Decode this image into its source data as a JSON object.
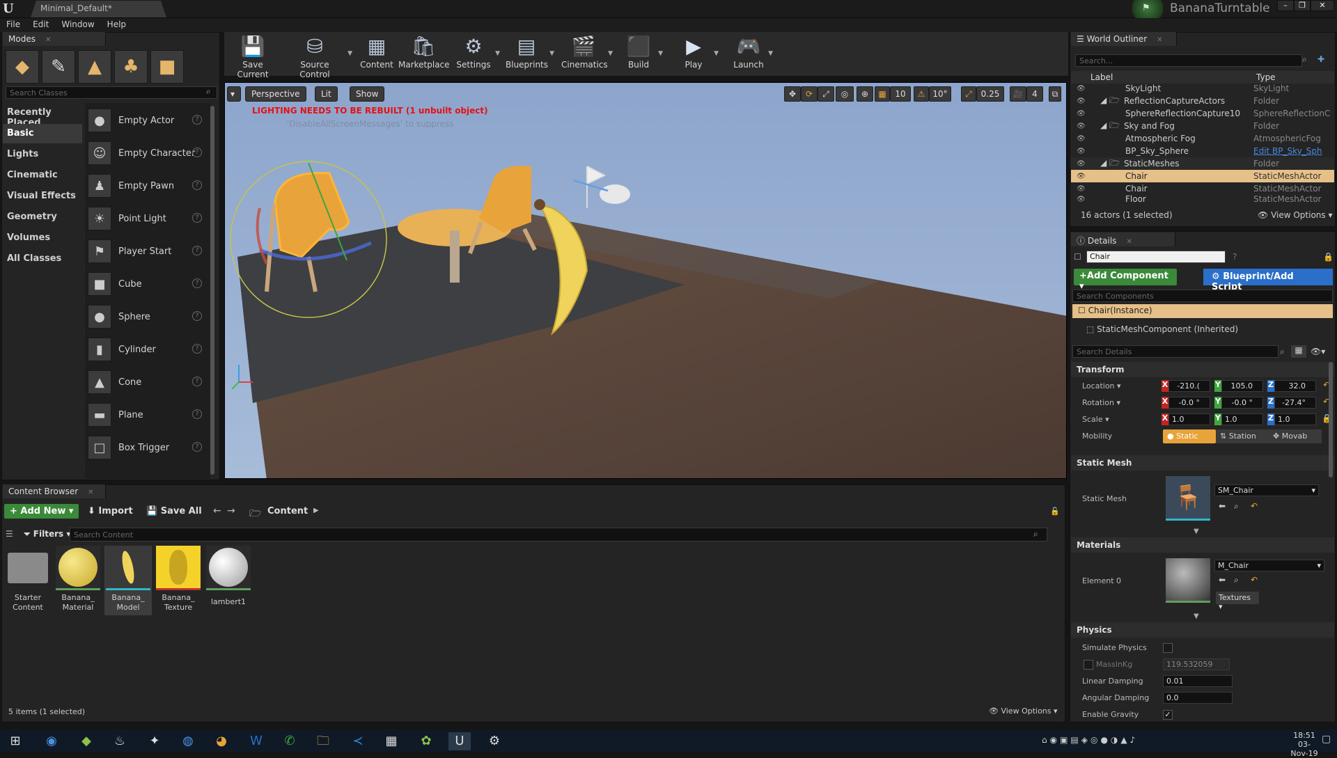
{
  "window": {
    "doc_tab": "Minimal_Default*",
    "project_name": "BananaTurntable"
  },
  "menu": [
    "File",
    "Edit",
    "Window",
    "Help"
  ],
  "modes": {
    "tab": "Modes",
    "search_placeholder": "Search Classes",
    "categories": [
      "Recently Placed",
      "Basic",
      "Lights",
      "Cinematic",
      "Visual Effects",
      "Geometry",
      "Volumes",
      "All Classes"
    ],
    "selected_category": "Basic",
    "items": [
      "Empty Actor",
      "Empty Character",
      "Empty Pawn",
      "Point Light",
      "Player Start",
      "Cube",
      "Sphere",
      "Cylinder",
      "Cone",
      "Plane",
      "Box Trigger"
    ]
  },
  "toolbar": [
    "Save Current",
    "Source Control",
    "Content",
    "Marketplace",
    "Settings",
    "Blueprints",
    "Cinematics",
    "Build",
    "Play",
    "Launch"
  ],
  "viewport": {
    "perspective": "Perspective",
    "lit": "Lit",
    "show": "Show",
    "warning": "LIGHTING NEEDS TO BE REBUILT (1 unbuilt object)",
    "suppress": "'DisableAllScreenMessages' to suppress",
    "grid_snap": "10",
    "rot_snap": "10°",
    "scale_snap": "0.25",
    "cam_speed": "4"
  },
  "content_browser": {
    "tab": "Content Browser",
    "add_new": "Add New",
    "import": "Import",
    "save_all": "Save All",
    "path": "Content",
    "filters": "Filters",
    "search_placeholder": "Search Content",
    "assets": [
      {
        "l1": "Starter",
        "l2": "Content"
      },
      {
        "l1": "Banana_",
        "l2": "Material"
      },
      {
        "l1": "Banana_",
        "l2": "Model"
      },
      {
        "l1": "Banana_",
        "l2": "Texture"
      },
      {
        "l1": "lambert1",
        "l2": ""
      }
    ],
    "status": "5 items (1 selected)",
    "view_options": "View Options"
  },
  "outliner": {
    "tab": "World Outliner",
    "search_placeholder": "Search...",
    "col_label": "Label",
    "col_type": "Type",
    "rows": [
      {
        "label": "SkyLight",
        "type": "SkyLight"
      },
      {
        "label": "ReflectionCaptureActors",
        "type": "Folder"
      },
      {
        "label": "SphereReflectionCapture10",
        "type": "SphereReflectionC"
      },
      {
        "label": "Sky and Fog",
        "type": "Folder"
      },
      {
        "label": "Atmospheric Fog",
        "type": "AtmosphericFog"
      },
      {
        "label": "BP_Sky_Sphere",
        "type": "Edit BP_Sky_Sph"
      },
      {
        "label": "StaticMeshes",
        "type": "Folder"
      },
      {
        "label": "Chair",
        "type": "StaticMeshActor"
      },
      {
        "label": "Chair",
        "type": "StaticMeshActor"
      },
      {
        "label": "Floor",
        "type": "StaticMeshActor"
      }
    ],
    "status": "16 actors (1 selected)",
    "view_options": "View Options"
  },
  "details": {
    "tab": "Details",
    "name": "Chair",
    "add_component": "Add Component",
    "blueprint": "Blueprint/Add Script",
    "search_components": "Search Components",
    "instance": "Chair(Instance)",
    "component": "StaticMeshComponent (Inherited)",
    "search_details": "Search Details",
    "transform": "Transform",
    "location_label": "Location",
    "rotation_label": "Rotation",
    "scale_label": "Scale",
    "mobility_label": "Mobility",
    "loc": [
      "-210.(",
      "105.0",
      "32.0"
    ],
    "rot": [
      "-0.0 °",
      "-0.0 °",
      "-27.4°"
    ],
    "scale": [
      "1.0",
      "1.0",
      "1.0"
    ],
    "mobility": [
      "Static",
      "Station",
      "Movab"
    ],
    "static_mesh_section": "Static Mesh",
    "static_mesh_label": "Static Mesh",
    "static_mesh_value": "SM_Chair",
    "materials_section": "Materials",
    "element0": "Element 0",
    "material_value": "M_Chair",
    "textures": "Textures",
    "physics_section": "Physics",
    "simulate": "Simulate Physics",
    "mass": "MassInKg",
    "mass_value": "119.532059",
    "linear": "Linear Damping",
    "linear_value": "0.01",
    "angular": "Angular Damping",
    "angular_value": "0.0",
    "gravity": "Enable Gravity"
  },
  "taskbar": {
    "time": "18:51",
    "date": "03-Nov-19"
  },
  "colors": {
    "accent_orange": "#e8a33a",
    "green": "#3a8a3a",
    "blue": "#2a6fc9",
    "warning_red": "#e81010"
  }
}
